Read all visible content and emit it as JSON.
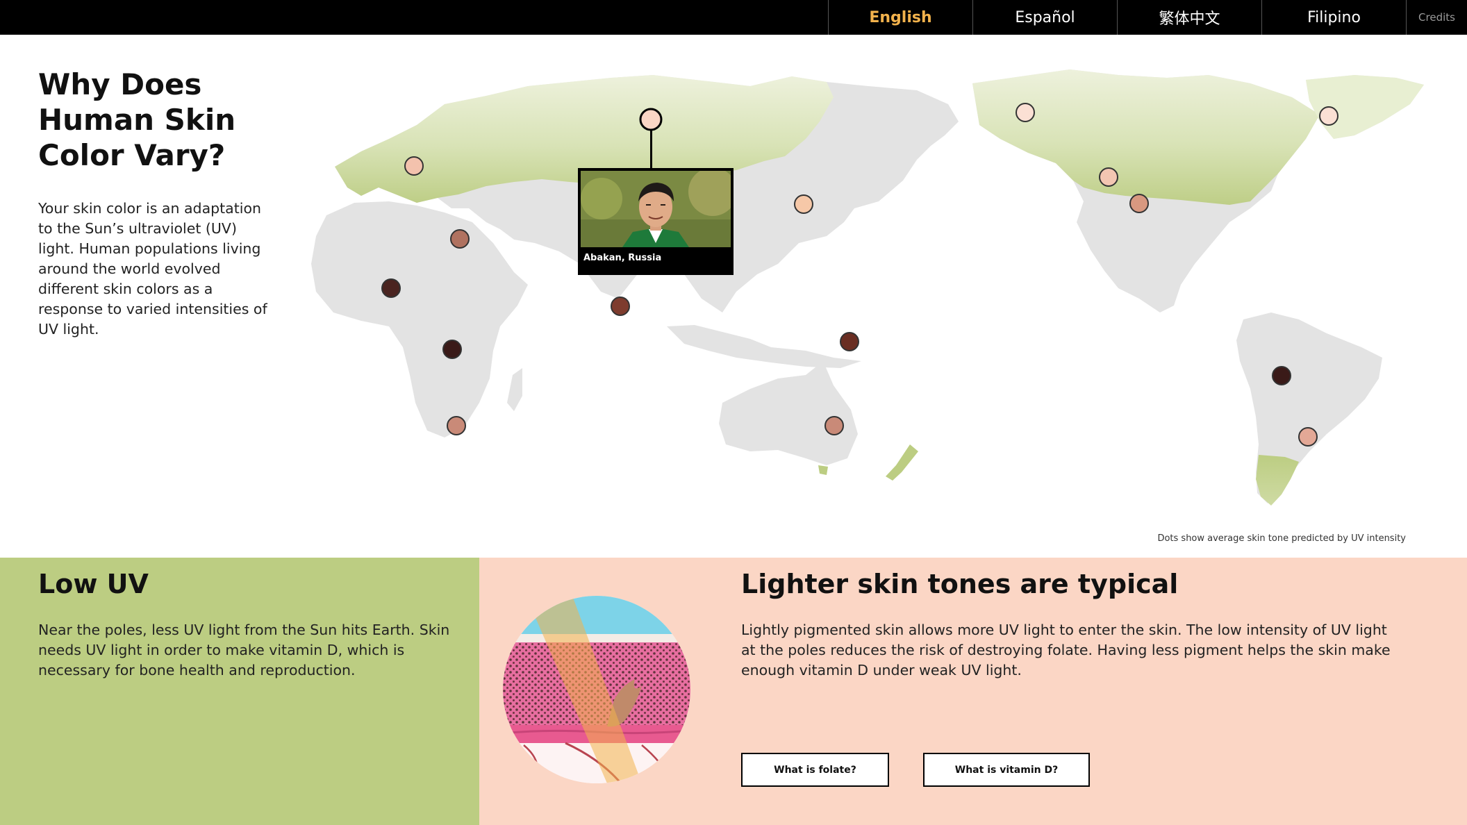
{
  "nav": {
    "languages": [
      {
        "label": "English",
        "active": true
      },
      {
        "label": "Español",
        "active": false
      },
      {
        "label": "繁体中文",
        "active": false
      },
      {
        "label": "Filipino",
        "active": false
      }
    ],
    "credits_label": "Credits"
  },
  "intro": {
    "title": "Why Does Human Skin Color Vary?",
    "body": "Your skin color is an adaptation to the Sun’s ultraviolet (UV) light. Human populations living around the world evolved different skin colors as a response to varied intensities of UV light."
  },
  "map": {
    "caption": "Dots show average skin tone predicted by UV intensity",
    "selected_location": "Abakan, Russia",
    "low_uv_color": "#bccd82",
    "land_color": "#e3e3e3"
  },
  "low_uv": {
    "heading": "Low UV",
    "body": "Near the poles, less UV light from the Sun hits Earth. Skin needs UV light in order to make vitamin D, which is necessary for bone health and reproduction."
  },
  "lighter": {
    "heading": "Lighter skin tones are typical",
    "body": "Lightly pigmented skin allows more UV light to enter the skin. The low intensity of UV light at the poles reduces the risk of destroying folate. Having less pigment helps the skin make enough vitamin D under weak UV light.",
    "button_folate": "What is folate?",
    "button_vitamin_d": "What is vitamin D?"
  }
}
